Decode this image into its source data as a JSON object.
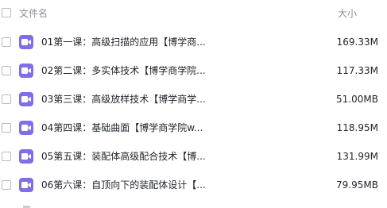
{
  "header": {
    "name_label": "文件名",
    "size_label": "大小"
  },
  "files": [
    {
      "name": "01第一课：高级扫描的应用【博学商...",
      "size": "169.33M",
      "icon": "video-file-icon"
    },
    {
      "name": "02第二课：多实体技术【博学商学院...",
      "size": "117.33M",
      "icon": "video-file-icon"
    },
    {
      "name": "03第三课：高级放样技术【博学商学...",
      "size": "51.00MB",
      "icon": "video-file-icon"
    },
    {
      "name": "04第四课：基础曲面【博学商学院w...",
      "size": "118.95M",
      "icon": "video-file-icon"
    },
    {
      "name": "05第五课：装配体高级配合技术【博...",
      "size": "131.99M",
      "icon": "video-file-icon"
    },
    {
      "name": "06第六课：自顶向下的装配体设计【...",
      "size": "79.95MB",
      "icon": "video-file-icon"
    }
  ],
  "colors": {
    "icon_bg": "#7e6ee8",
    "text": "#1f2329",
    "header_text": "#8a8f99"
  }
}
